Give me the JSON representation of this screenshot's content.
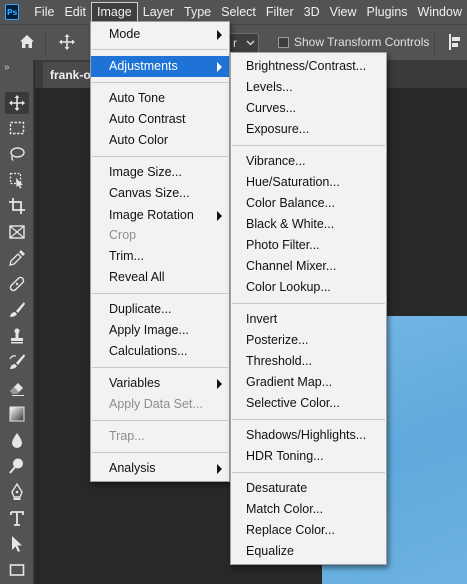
{
  "app": {
    "logo_text": "Ps"
  },
  "menubar": {
    "items": [
      "File",
      "Edit",
      "Image",
      "Layer",
      "Type",
      "Select",
      "Filter",
      "3D",
      "View",
      "Plugins",
      "Window"
    ],
    "active_index": 2
  },
  "options_bar": {
    "dropdown_value": "r",
    "show_transform_label": "Show Transform Controls",
    "show_transform_checked": false
  },
  "toolbar": {
    "collapse_glyph": "»",
    "tools": [
      "move-tool",
      "marquee-tool",
      "lasso-tool",
      "object-selection-tool",
      "crop-tool",
      "frame-tool",
      "eyedropper-tool",
      "healing-brush-tool",
      "brush-tool",
      "clone-stamp-tool",
      "history-brush-tool",
      "eraser-tool",
      "gradient-tool",
      "blur-tool",
      "dodge-tool",
      "pen-tool",
      "type-tool",
      "path-selection-tool",
      "rectangle-tool"
    ]
  },
  "document": {
    "tab_label": "frank-o"
  },
  "image_menu": {
    "items": [
      {
        "label": "Mode",
        "submenu": true
      },
      {
        "label": "Adjustments",
        "submenu": true,
        "highlight": true
      },
      {
        "label": "Auto Tone"
      },
      {
        "label": "Auto Contrast"
      },
      {
        "label": "Auto Color"
      },
      {
        "label": "Image Size..."
      },
      {
        "label": "Canvas Size..."
      },
      {
        "label": "Image Rotation",
        "submenu": true
      },
      {
        "label": "Crop",
        "disabled": true
      },
      {
        "label": "Trim..."
      },
      {
        "label": "Reveal All"
      },
      {
        "label": "Duplicate..."
      },
      {
        "label": "Apply Image..."
      },
      {
        "label": "Calculations..."
      },
      {
        "label": "Variables",
        "submenu": true
      },
      {
        "label": "Apply Data Set...",
        "disabled": true
      },
      {
        "label": "Trap...",
        "disabled": true
      },
      {
        "label": "Analysis",
        "submenu": true
      }
    ]
  },
  "adjustments_menu": {
    "items": [
      "Brightness/Contrast...",
      "Levels...",
      "Curves...",
      "Exposure...",
      "Vibrance...",
      "Hue/Saturation...",
      "Color Balance...",
      "Black & White...",
      "Photo Filter...",
      "Channel Mixer...",
      "Color Lookup...",
      "Invert",
      "Posterize...",
      "Threshold...",
      "Gradient Map...",
      "Selective Color...",
      "Shadows/Highlights...",
      "HDR Toning...",
      "Desaturate",
      "Match Color...",
      "Replace Color...",
      "Equalize"
    ]
  },
  "colors": {
    "highlight": "#1f73d6",
    "menu_bg": "#f2f2f2",
    "chrome": "#535353",
    "canvas_bg": "#282828",
    "photo_blue": "#6cb2e1"
  }
}
